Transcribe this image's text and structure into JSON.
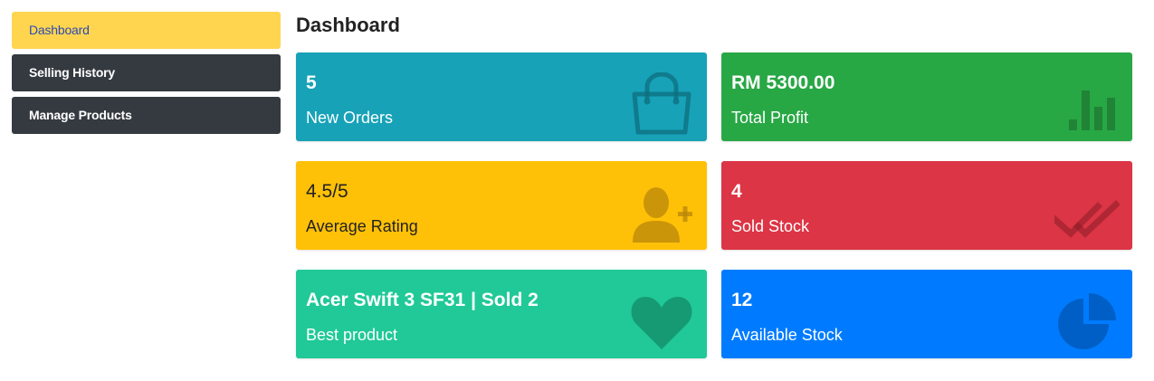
{
  "sidebar": {
    "items": [
      {
        "label": "Dashboard",
        "active": true
      },
      {
        "label": "Selling History",
        "active": false
      },
      {
        "label": "Manage Products",
        "active": false
      }
    ]
  },
  "main": {
    "title": "Dashboard",
    "cards": [
      {
        "value": "5",
        "label": "New Orders",
        "color": "#17a2b8",
        "icon": "shopping-bag-icon"
      },
      {
        "value": "RM 5300.00",
        "label": "Total Profit",
        "color": "#28a745",
        "icon": "bar-chart-icon"
      },
      {
        "value": "4.5/5",
        "label": "Average Rating",
        "color": "#ffc107",
        "icon": "user-plus-icon"
      },
      {
        "value": "4",
        "label": "Sold Stock",
        "color": "#dc3545",
        "icon": "double-check-icon"
      },
      {
        "value": "Acer Swift 3 SF31 | Sold 2",
        "label": "Best product",
        "color": "#20c997",
        "icon": "heart-icon"
      },
      {
        "value": "12",
        "label": "Available Stock",
        "color": "#007bff",
        "icon": "pie-chart-icon"
      }
    ]
  }
}
